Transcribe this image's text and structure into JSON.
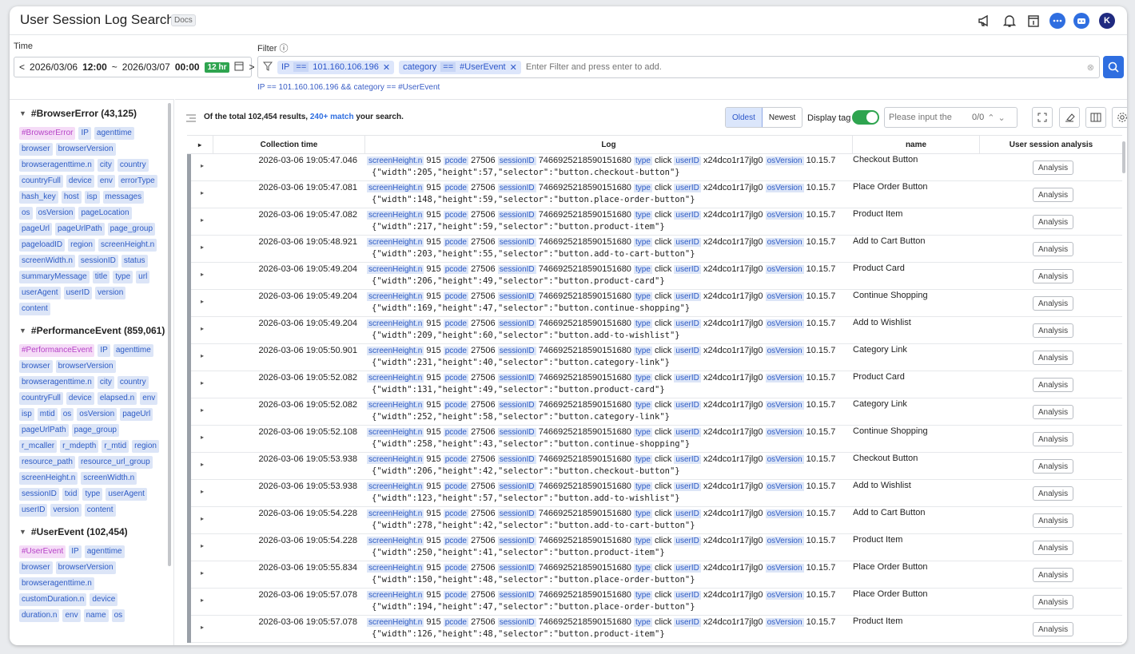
{
  "app": {
    "title": "User Session Log Search",
    "docs_label": "Docs"
  },
  "header_icons": [
    "megaphone-icon",
    "bell-icon",
    "calendar-icon",
    "chat-icon",
    "bot-icon",
    "avatar"
  ],
  "avatar_letter": "K",
  "time": {
    "label": "Time",
    "start_date": "2026/03/06",
    "start_time": "12:00",
    "sep": "~",
    "end_date": "2026/03/07",
    "end_time": "00:00",
    "range_badge": "12 hr"
  },
  "filter": {
    "label": "Filter",
    "chips": [
      {
        "field": "IP",
        "op": "==",
        "value": "101.160.106.196"
      },
      {
        "field": "category",
        "op": "==",
        "value": "#UserEvent"
      }
    ],
    "placeholder": "Enter Filter and press enter to add.",
    "query": "IP == 101.160.106.196 && category == #UserEvent"
  },
  "sidebar": {
    "groups": [
      {
        "title": "#BrowserError (43,125)",
        "tags": [
          "#BrowserError",
          "IP",
          "agenttime",
          "browser",
          "browserVersion",
          "browseragenttime.n",
          "city",
          "country",
          "countryFull",
          "device",
          "env",
          "errorType",
          "hash_key",
          "host",
          "isp",
          "messages",
          "os",
          "osVersion",
          "pageLocation",
          "pageUrl",
          "pageUrlPath",
          "page_group",
          "pageloadID",
          "region",
          "screenHeight.n",
          "screenWidth.n",
          "sessionID",
          "status",
          "summaryMessage",
          "title",
          "type",
          "url",
          "userAgent",
          "userID",
          "version",
          "content"
        ]
      },
      {
        "title": "#PerformanceEvent (859,061)",
        "tags": [
          "#PerformanceEvent",
          "IP",
          "agenttime",
          "browser",
          "browserVersion",
          "browseragenttime.n",
          "city",
          "country",
          "countryFull",
          "device",
          "elapsed.n",
          "env",
          "isp",
          "mtid",
          "os",
          "osVersion",
          "pageUrl",
          "pageUrlPath",
          "page_group",
          "r_mcaller",
          "r_mdepth",
          "r_mtid",
          "region",
          "resource_path",
          "resource_url_group",
          "screenHeight.n",
          "screenWidth.n",
          "sessionID",
          "txid",
          "type",
          "userAgent",
          "userID",
          "version",
          "content"
        ]
      },
      {
        "title": "#UserEvent (102,454)",
        "tags": [
          "#UserEvent",
          "IP",
          "agenttime",
          "browser",
          "browserVersion",
          "browseragenttime.n",
          "customDuration.n",
          "device",
          "duration.n",
          "env",
          "name",
          "os"
        ]
      }
    ]
  },
  "results": {
    "prefix": "Of the total 102,454 results, ",
    "match": "240+ match",
    "suffix": " your search.",
    "oldest": "Oldest",
    "newest": "Newest",
    "display_tag": "Display tag",
    "find_placeholder": "Please input the",
    "find_count": "0/0"
  },
  "columns": {
    "time": "Collection time",
    "log": "Log",
    "name": "name",
    "analysis": "User session analysis"
  },
  "log_fields": {
    "screenHeight": "screenHeight.n",
    "screenHeight_val": "915",
    "pcode": "pcode",
    "pcode_val": "27506",
    "sessionID": "sessionID",
    "sessionID_val": "7466925218590151680",
    "type": "type",
    "type_val": "click",
    "userID": "userID",
    "userID_val": "x24dco1r17jlg0",
    "osVersion": "osVersion",
    "osVersion_val": "10.15.7"
  },
  "analysis_label": "Analysis",
  "rows": [
    {
      "time": "2026-03-06 19:05:47.046",
      "json": "{\"width\":205,\"height\":57,\"selector\":\"button.checkout-button\"}",
      "name": "Checkout Button"
    },
    {
      "time": "2026-03-06 19:05:47.081",
      "json": "{\"width\":148,\"height\":59,\"selector\":\"button.place-order-button\"}",
      "name": "Place Order Button"
    },
    {
      "time": "2026-03-06 19:05:47.082",
      "json": "{\"width\":217,\"height\":59,\"selector\":\"button.product-item\"}",
      "name": "Product Item"
    },
    {
      "time": "2026-03-06 19:05:48.921",
      "json": "{\"width\":203,\"height\":55,\"selector\":\"button.add-to-cart-button\"}",
      "name": "Add to Cart Button"
    },
    {
      "time": "2026-03-06 19:05:49.204",
      "json": "{\"width\":206,\"height\":49,\"selector\":\"button.product-card\"}",
      "name": "Product Card"
    },
    {
      "time": "2026-03-06 19:05:49.204",
      "json": "{\"width\":169,\"height\":47,\"selector\":\"button.continue-shopping\"}",
      "name": "Continue Shopping"
    },
    {
      "time": "2026-03-06 19:05:49.204",
      "json": "{\"width\":209,\"height\":60,\"selector\":\"button.add-to-wishlist\"}",
      "name": "Add to Wishlist"
    },
    {
      "time": "2026-03-06 19:05:50.901",
      "json": "{\"width\":231,\"height\":40,\"selector\":\"button.category-link\"}",
      "name": "Category Link"
    },
    {
      "time": "2026-03-06 19:05:52.082",
      "json": "{\"width\":131,\"height\":49,\"selector\":\"button.product-card\"}",
      "name": "Product Card"
    },
    {
      "time": "2026-03-06 19:05:52.082",
      "json": "{\"width\":252,\"height\":58,\"selector\":\"button.category-link\"}",
      "name": "Category Link"
    },
    {
      "time": "2026-03-06 19:05:52.108",
      "json": "{\"width\":258,\"height\":43,\"selector\":\"button.continue-shopping\"}",
      "name": "Continue Shopping"
    },
    {
      "time": "2026-03-06 19:05:53.938",
      "json": "{\"width\":206,\"height\":42,\"selector\":\"button.checkout-button\"}",
      "name": "Checkout Button"
    },
    {
      "time": "2026-03-06 19:05:53.938",
      "json": "{\"width\":123,\"height\":57,\"selector\":\"button.add-to-wishlist\"}",
      "name": "Add to Wishlist"
    },
    {
      "time": "2026-03-06 19:05:54.228",
      "json": "{\"width\":278,\"height\":42,\"selector\":\"button.add-to-cart-button\"}",
      "name": "Add to Cart Button"
    },
    {
      "time": "2026-03-06 19:05:54.228",
      "json": "{\"width\":250,\"height\":41,\"selector\":\"button.product-item\"}",
      "name": "Product Item"
    },
    {
      "time": "2026-03-06 19:05:55.834",
      "json": "{\"width\":150,\"height\":48,\"selector\":\"button.place-order-button\"}",
      "name": "Place Order Button"
    },
    {
      "time": "2026-03-06 19:05:57.078",
      "json": "{\"width\":194,\"height\":47,\"selector\":\"button.place-order-button\"}",
      "name": "Place Order Button"
    },
    {
      "time": "2026-03-06 19:05:57.078",
      "json": "{\"width\":126,\"height\":48,\"selector\":\"button.product-item\"}",
      "name": "Product Item"
    }
  ]
}
